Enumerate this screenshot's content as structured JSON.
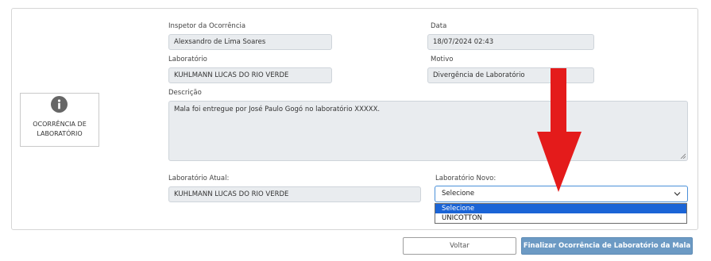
{
  "side_card": {
    "label": "OCORRÊNCIA DE LABORATÓRIO",
    "icon": "info-circle-icon"
  },
  "fields": {
    "inspetor": {
      "label": "Inspetor da Ocorrência",
      "value": "Alexsandro de Lima Soares"
    },
    "data": {
      "label": "Data",
      "value": "18/07/2024 02:43"
    },
    "laboratorio": {
      "label": "Laboratório",
      "value": "KUHLMANN LUCAS DO RIO VERDE"
    },
    "motivo": {
      "label": "Motivo",
      "value": "Divergência de Laboratório"
    },
    "descricao": {
      "label": "Descrição",
      "value": "Mala foi entregue por José Paulo Gogó no laboratório XXXXX."
    },
    "lab_atual": {
      "label": "Laboratório Atual:",
      "value": "KUHLMANN LUCAS DO RIO VERDE"
    },
    "lab_novo": {
      "label": "Laboratório Novo:",
      "selected": "Selecione",
      "options": [
        "Selecione",
        "UNICOTTON"
      ]
    }
  },
  "buttons": {
    "back": "Voltar",
    "finish": "Finalizar Ocorrência de Laboratório da Mala"
  },
  "colors": {
    "arrow": "#e41b1b",
    "finish_button": "#6c9ac4",
    "selected_option": "#1a64d6"
  }
}
